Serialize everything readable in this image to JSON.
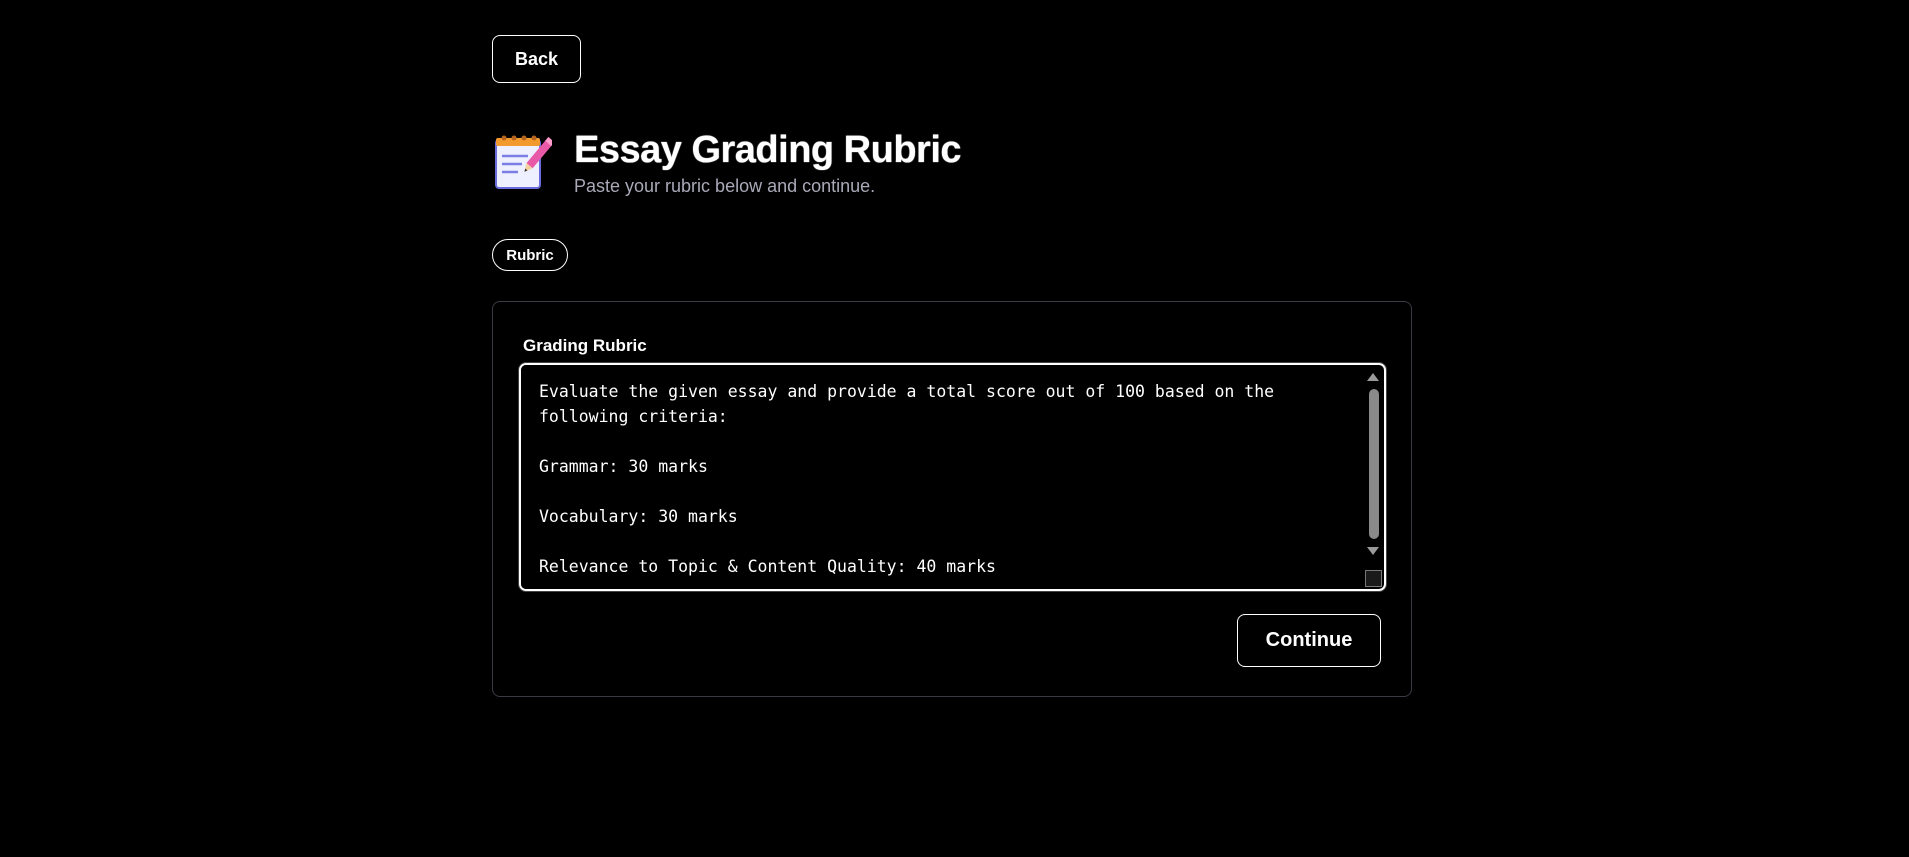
{
  "nav": {
    "back_label": "Back"
  },
  "header": {
    "icon": "memo-icon",
    "title": "Essay Grading Rubric",
    "subtitle": "Paste your rubric below and continue."
  },
  "tabs": {
    "active_label": "Rubric"
  },
  "form": {
    "field_label": "Grading Rubric",
    "rubric_text": "Evaluate the given essay and provide a total score out of 100 based on the\nfollowing criteria:\n\nGrammar: 30 marks\n\nVocabulary: 30 marks\n\nRelevance to Topic & Content Quality: 40 marks",
    "continue_label": "Continue"
  },
  "colors": {
    "background": "#000000",
    "text": "#ffffff",
    "subtitle": "#a9a9b8",
    "card_border": "#3a3a44"
  }
}
